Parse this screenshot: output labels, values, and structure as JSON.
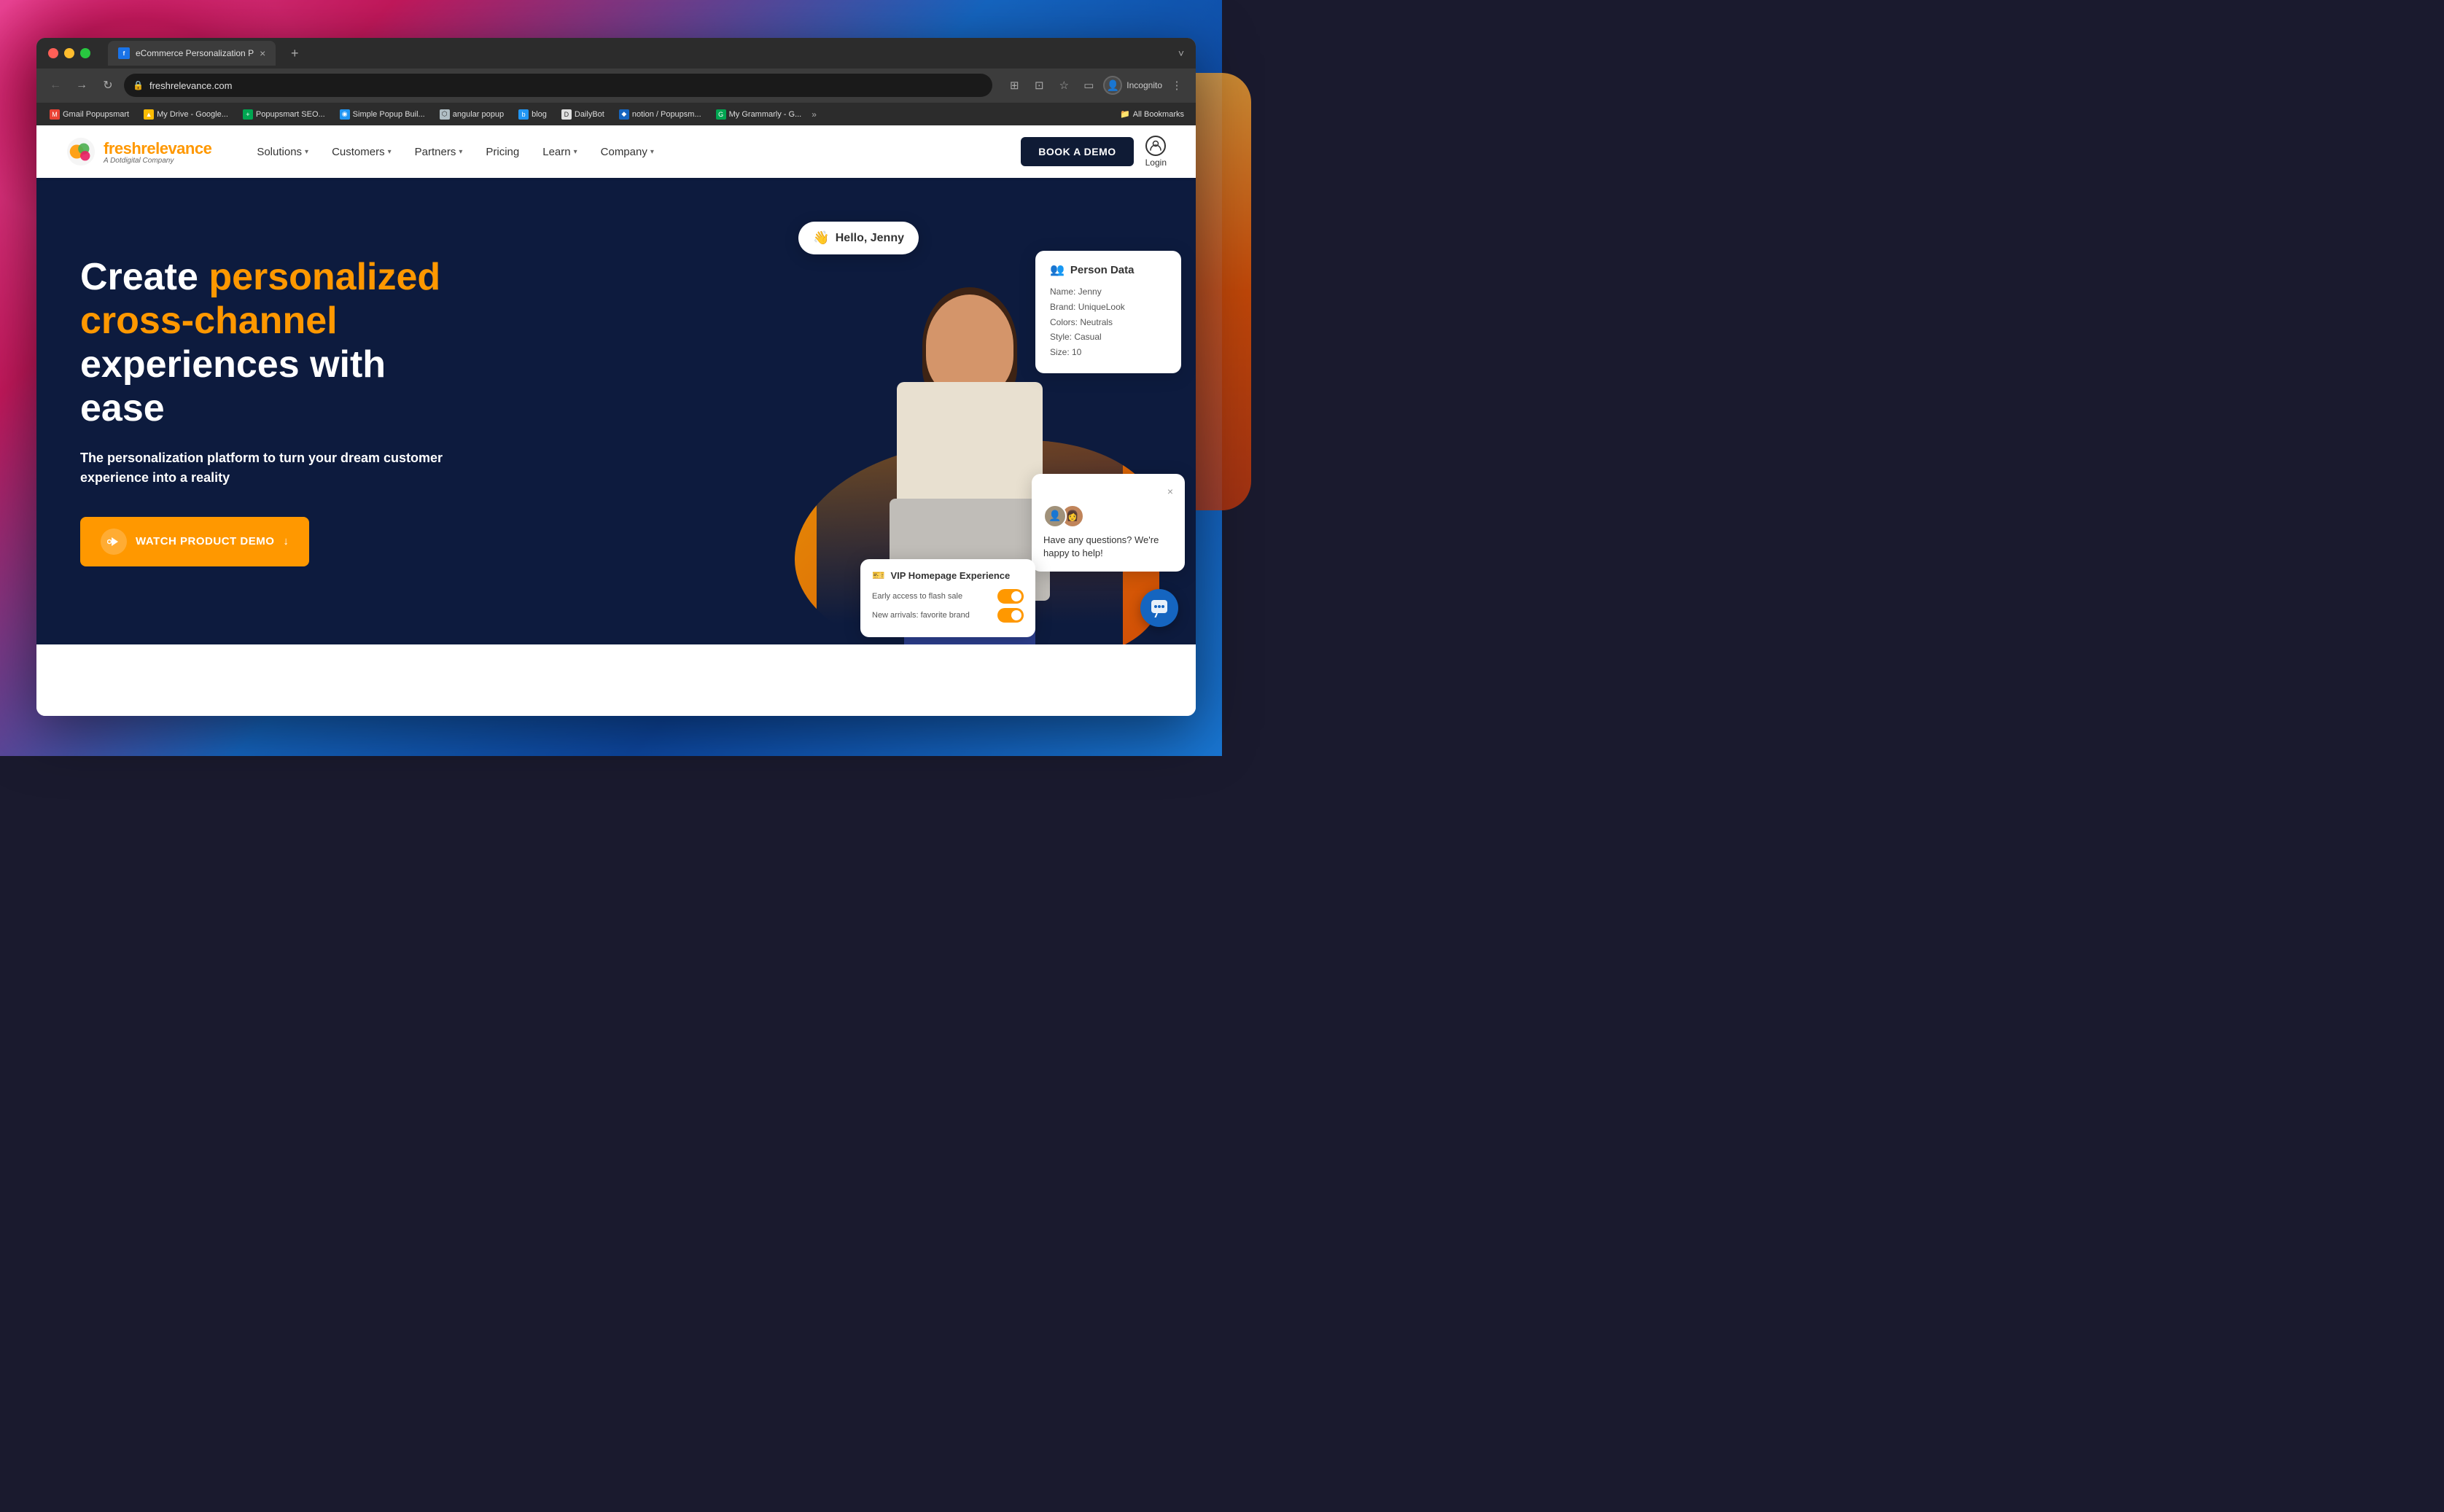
{
  "browser": {
    "tab_title": "eCommerce Personalization P",
    "tab_close": "×",
    "tab_new": "+",
    "tab_dropdown": "˅",
    "url": "freshrelevance.com",
    "nav_back": "←",
    "nav_forward": "→",
    "nav_refresh": "↻",
    "incognito_label": "Incognito",
    "profile_icon": "👤",
    "bookmarks": [
      {
        "label": "Gmail Popupsmart",
        "icon": "M",
        "type": "gmail"
      },
      {
        "label": "My Drive - Google...",
        "icon": "▲",
        "type": "drive"
      },
      {
        "label": "Popupsmart SEO...",
        "icon": "P",
        "type": "popupsmart"
      },
      {
        "label": "Simple Popup Buil...",
        "icon": "S",
        "type": "popup2"
      },
      {
        "label": "angular popup",
        "icon": "⬡",
        "type": "angular"
      },
      {
        "label": "blog",
        "icon": "b",
        "type": "blog"
      },
      {
        "label": "DailyBot",
        "icon": "D",
        "type": "daily"
      },
      {
        "label": "notion / Popupsm...",
        "icon": "N",
        "type": "notion"
      },
      {
        "label": "My Grammarly - G...",
        "icon": "G",
        "type": "grammar"
      }
    ],
    "all_bookmarks_label": "All Bookmarks"
  },
  "site": {
    "logo_name_part1": "fresh",
    "logo_name_part2": "relevance",
    "logo_sub": "A Dotdigital Company",
    "nav_links": [
      {
        "label": "Solutions",
        "has_dropdown": true
      },
      {
        "label": "Customers",
        "has_dropdown": true
      },
      {
        "label": "Partners",
        "has_dropdown": true
      },
      {
        "label": "Pricing",
        "has_dropdown": false
      },
      {
        "label": "Learn",
        "has_dropdown": true
      },
      {
        "label": "Company",
        "has_dropdown": true
      }
    ],
    "book_demo_label": "BOOK A DEMO",
    "login_label": "Login"
  },
  "hero": {
    "title_line1": "Create ",
    "title_highlight": "personalized cross-channel",
    "title_line2": " experiences with ease",
    "subtitle": "The personalization platform to turn your dream customer experience into a reality",
    "cta_label": "WATCH PRODUCT DEMO",
    "cta_arrow": "↓"
  },
  "hello_bubble": {
    "emoji": "👋",
    "text": "Hello, Jenny"
  },
  "person_data_card": {
    "title": "Person Data",
    "rows": [
      "Name: Jenny",
      "Brand: UniqueLook",
      "Colors: Neutrals",
      "Style: Casual",
      "Size: 10"
    ]
  },
  "chat_widget": {
    "text": "Have any questions? We're happy to help!",
    "close": "×"
  },
  "vip_card": {
    "title": "VIP Homepage Experience",
    "rows": [
      "Early access to flash sale",
      "New arrivals: favorite brand"
    ]
  },
  "colors": {
    "hero_bg": "#0d1b3e",
    "orange": "#ff9800",
    "dark_nav": "#0f1b35",
    "white": "#ffffff"
  }
}
